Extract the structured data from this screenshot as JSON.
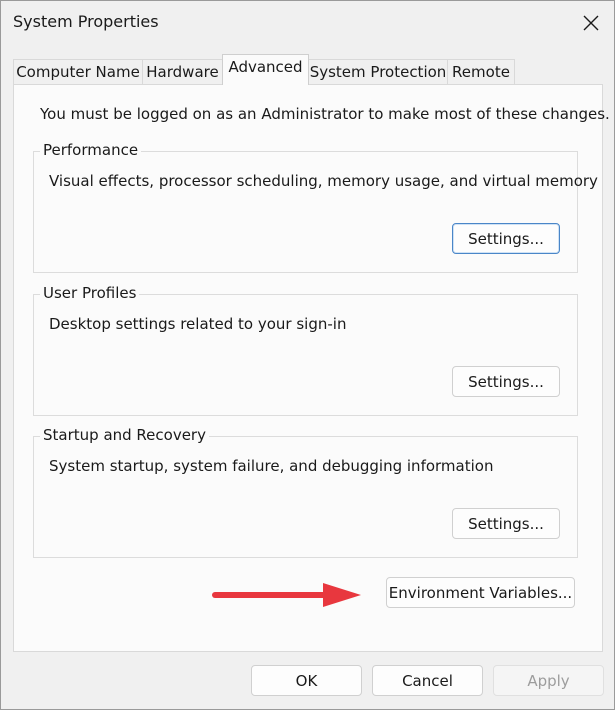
{
  "window": {
    "title": "System Properties"
  },
  "tabs": [
    {
      "label": "Computer Name"
    },
    {
      "label": "Hardware"
    },
    {
      "label": "Advanced"
    },
    {
      "label": "System Protection"
    },
    {
      "label": "Remote"
    }
  ],
  "active_tab": "Advanced",
  "notice": "You must be logged on as an Administrator to make most of these changes.",
  "groups": {
    "performance": {
      "title": "Performance",
      "description": "Visual effects, processor scheduling, memory usage, and virtual memory",
      "button": "Settings..."
    },
    "user_profiles": {
      "title": "User Profiles",
      "description": "Desktop settings related to your sign-in",
      "button": "Settings..."
    },
    "startup_recovery": {
      "title": "Startup and Recovery",
      "description": "System startup, system failure, and debugging information",
      "button": "Settings..."
    }
  },
  "env_button": "Environment Variables...",
  "footer": {
    "ok": "OK",
    "cancel": "Cancel",
    "apply": "Apply"
  },
  "colors": {
    "arrow": "#e8373e",
    "focus_border": "#4a86c8"
  },
  "icons": {
    "close": "close-icon",
    "annotation": "red-arrow-icon"
  }
}
